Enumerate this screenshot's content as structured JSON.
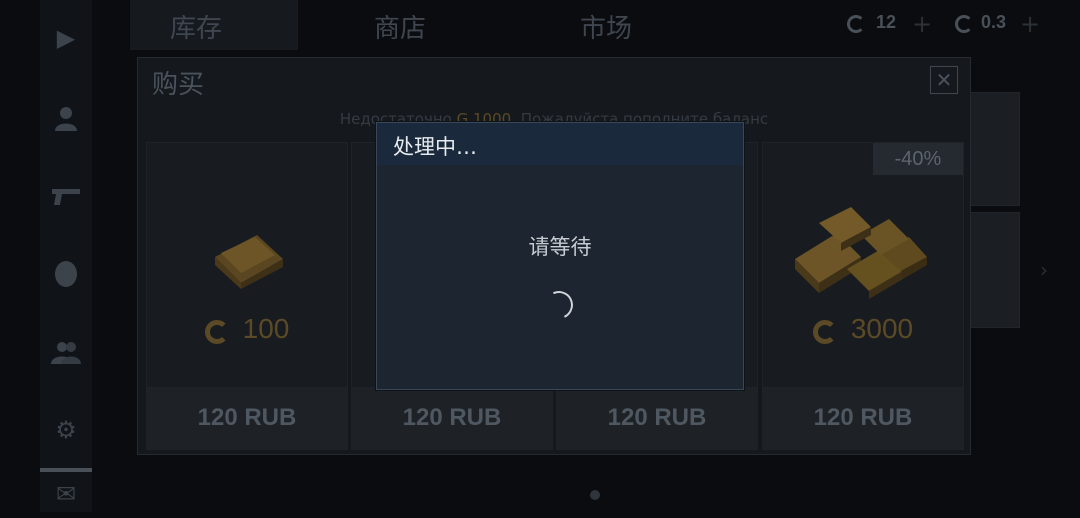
{
  "tabs": [
    {
      "label": "库存"
    },
    {
      "label": "商店"
    },
    {
      "label": "市场"
    }
  ],
  "currency": {
    "c_value": "12",
    "g_value": "0.3"
  },
  "purchase_dialog": {
    "title": "购买",
    "message_prefix": "Недостаточно",
    "message_amount": "G 1000",
    "message_suffix": ". Пожалуйста пополните баланс",
    "cards": [
      {
        "amount": "100",
        "price": "120 RUB"
      },
      {
        "amount": "",
        "price": "120 RUB"
      },
      {
        "amount": "",
        "price": "120 RUB"
      },
      {
        "amount": "3000",
        "price": "120 RUB",
        "discount": "-40%"
      }
    ]
  },
  "processing": {
    "title": "处理中…",
    "message": "请等待"
  },
  "colors": {
    "gold": "#c28a24",
    "dialog_bg": "#1c2530",
    "dialog_header": "#1a2a3c"
  }
}
